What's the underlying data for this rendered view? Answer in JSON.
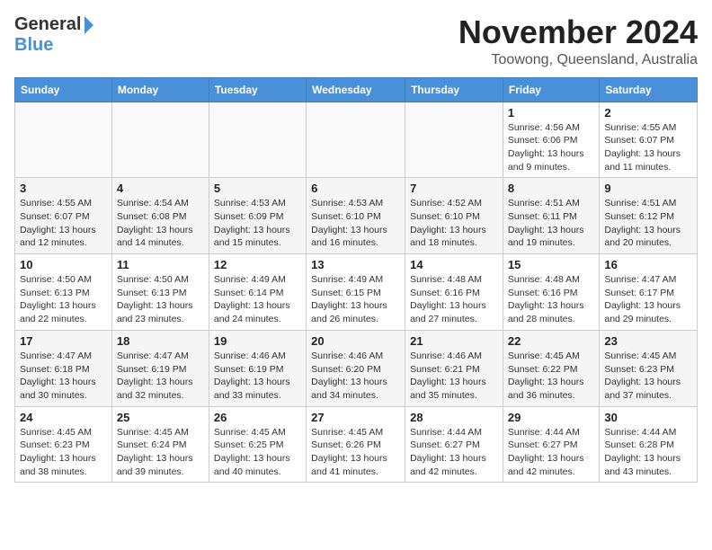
{
  "header": {
    "logo_general": "General",
    "logo_blue": "Blue",
    "month": "November 2024",
    "location": "Toowong, Queensland, Australia"
  },
  "weekdays": [
    "Sunday",
    "Monday",
    "Tuesday",
    "Wednesday",
    "Thursday",
    "Friday",
    "Saturday"
  ],
  "weeks": [
    [
      {
        "day": "",
        "sunrise": "",
        "sunset": "",
        "daylight": "",
        "empty": true
      },
      {
        "day": "",
        "sunrise": "",
        "sunset": "",
        "daylight": "",
        "empty": true
      },
      {
        "day": "",
        "sunrise": "",
        "sunset": "",
        "daylight": "",
        "empty": true
      },
      {
        "day": "",
        "sunrise": "",
        "sunset": "",
        "daylight": "",
        "empty": true
      },
      {
        "day": "",
        "sunrise": "",
        "sunset": "",
        "daylight": "",
        "empty": true
      },
      {
        "day": "1",
        "sunrise": "Sunrise: 4:56 AM",
        "sunset": "Sunset: 6:06 PM",
        "daylight": "Daylight: 13 hours and 9 minutes.",
        "empty": false
      },
      {
        "day": "2",
        "sunrise": "Sunrise: 4:55 AM",
        "sunset": "Sunset: 6:07 PM",
        "daylight": "Daylight: 13 hours and 11 minutes.",
        "empty": false
      }
    ],
    [
      {
        "day": "3",
        "sunrise": "Sunrise: 4:55 AM",
        "sunset": "Sunset: 6:07 PM",
        "daylight": "Daylight: 13 hours and 12 minutes.",
        "empty": false
      },
      {
        "day": "4",
        "sunrise": "Sunrise: 4:54 AM",
        "sunset": "Sunset: 6:08 PM",
        "daylight": "Daylight: 13 hours and 14 minutes.",
        "empty": false
      },
      {
        "day": "5",
        "sunrise": "Sunrise: 4:53 AM",
        "sunset": "Sunset: 6:09 PM",
        "daylight": "Daylight: 13 hours and 15 minutes.",
        "empty": false
      },
      {
        "day": "6",
        "sunrise": "Sunrise: 4:53 AM",
        "sunset": "Sunset: 6:10 PM",
        "daylight": "Daylight: 13 hours and 16 minutes.",
        "empty": false
      },
      {
        "day": "7",
        "sunrise": "Sunrise: 4:52 AM",
        "sunset": "Sunset: 6:10 PM",
        "daylight": "Daylight: 13 hours and 18 minutes.",
        "empty": false
      },
      {
        "day": "8",
        "sunrise": "Sunrise: 4:51 AM",
        "sunset": "Sunset: 6:11 PM",
        "daylight": "Daylight: 13 hours and 19 minutes.",
        "empty": false
      },
      {
        "day": "9",
        "sunrise": "Sunrise: 4:51 AM",
        "sunset": "Sunset: 6:12 PM",
        "daylight": "Daylight: 13 hours and 20 minutes.",
        "empty": false
      }
    ],
    [
      {
        "day": "10",
        "sunrise": "Sunrise: 4:50 AM",
        "sunset": "Sunset: 6:13 PM",
        "daylight": "Daylight: 13 hours and 22 minutes.",
        "empty": false
      },
      {
        "day": "11",
        "sunrise": "Sunrise: 4:50 AM",
        "sunset": "Sunset: 6:13 PM",
        "daylight": "Daylight: 13 hours and 23 minutes.",
        "empty": false
      },
      {
        "day": "12",
        "sunrise": "Sunrise: 4:49 AM",
        "sunset": "Sunset: 6:14 PM",
        "daylight": "Daylight: 13 hours and 24 minutes.",
        "empty": false
      },
      {
        "day": "13",
        "sunrise": "Sunrise: 4:49 AM",
        "sunset": "Sunset: 6:15 PM",
        "daylight": "Daylight: 13 hours and 26 minutes.",
        "empty": false
      },
      {
        "day": "14",
        "sunrise": "Sunrise: 4:48 AM",
        "sunset": "Sunset: 6:16 PM",
        "daylight": "Daylight: 13 hours and 27 minutes.",
        "empty": false
      },
      {
        "day": "15",
        "sunrise": "Sunrise: 4:48 AM",
        "sunset": "Sunset: 6:16 PM",
        "daylight": "Daylight: 13 hours and 28 minutes.",
        "empty": false
      },
      {
        "day": "16",
        "sunrise": "Sunrise: 4:47 AM",
        "sunset": "Sunset: 6:17 PM",
        "daylight": "Daylight: 13 hours and 29 minutes.",
        "empty": false
      }
    ],
    [
      {
        "day": "17",
        "sunrise": "Sunrise: 4:47 AM",
        "sunset": "Sunset: 6:18 PM",
        "daylight": "Daylight: 13 hours and 30 minutes.",
        "empty": false
      },
      {
        "day": "18",
        "sunrise": "Sunrise: 4:47 AM",
        "sunset": "Sunset: 6:19 PM",
        "daylight": "Daylight: 13 hours and 32 minutes.",
        "empty": false
      },
      {
        "day": "19",
        "sunrise": "Sunrise: 4:46 AM",
        "sunset": "Sunset: 6:19 PM",
        "daylight": "Daylight: 13 hours and 33 minutes.",
        "empty": false
      },
      {
        "day": "20",
        "sunrise": "Sunrise: 4:46 AM",
        "sunset": "Sunset: 6:20 PM",
        "daylight": "Daylight: 13 hours and 34 minutes.",
        "empty": false
      },
      {
        "day": "21",
        "sunrise": "Sunrise: 4:46 AM",
        "sunset": "Sunset: 6:21 PM",
        "daylight": "Daylight: 13 hours and 35 minutes.",
        "empty": false
      },
      {
        "day": "22",
        "sunrise": "Sunrise: 4:45 AM",
        "sunset": "Sunset: 6:22 PM",
        "daylight": "Daylight: 13 hours and 36 minutes.",
        "empty": false
      },
      {
        "day": "23",
        "sunrise": "Sunrise: 4:45 AM",
        "sunset": "Sunset: 6:23 PM",
        "daylight": "Daylight: 13 hours and 37 minutes.",
        "empty": false
      }
    ],
    [
      {
        "day": "24",
        "sunrise": "Sunrise: 4:45 AM",
        "sunset": "Sunset: 6:23 PM",
        "daylight": "Daylight: 13 hours and 38 minutes.",
        "empty": false
      },
      {
        "day": "25",
        "sunrise": "Sunrise: 4:45 AM",
        "sunset": "Sunset: 6:24 PM",
        "daylight": "Daylight: 13 hours and 39 minutes.",
        "empty": false
      },
      {
        "day": "26",
        "sunrise": "Sunrise: 4:45 AM",
        "sunset": "Sunset: 6:25 PM",
        "daylight": "Daylight: 13 hours and 40 minutes.",
        "empty": false
      },
      {
        "day": "27",
        "sunrise": "Sunrise: 4:45 AM",
        "sunset": "Sunset: 6:26 PM",
        "daylight": "Daylight: 13 hours and 41 minutes.",
        "empty": false
      },
      {
        "day": "28",
        "sunrise": "Sunrise: 4:44 AM",
        "sunset": "Sunset: 6:27 PM",
        "daylight": "Daylight: 13 hours and 42 minutes.",
        "empty": false
      },
      {
        "day": "29",
        "sunrise": "Sunrise: 4:44 AM",
        "sunset": "Sunset: 6:27 PM",
        "daylight": "Daylight: 13 hours and 42 minutes.",
        "empty": false
      },
      {
        "day": "30",
        "sunrise": "Sunrise: 4:44 AM",
        "sunset": "Sunset: 6:28 PM",
        "daylight": "Daylight: 13 hours and 43 minutes.",
        "empty": false
      }
    ]
  ]
}
